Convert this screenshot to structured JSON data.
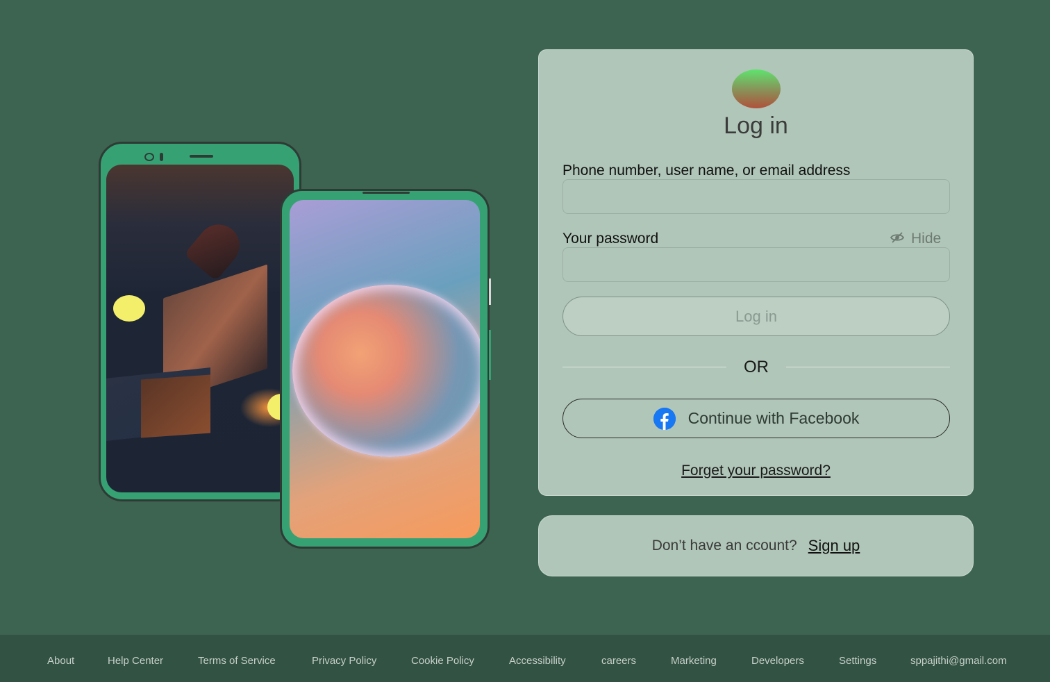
{
  "login": {
    "title": "Log in",
    "username_label": "Phone number, user name, or email address",
    "username_value": "",
    "password_label": "Your password",
    "password_value": "",
    "hide_label": "Hide",
    "submit_label": "Log in",
    "or_text": "OR",
    "facebook_label": "Continue with Facebook",
    "forgot_label": "Forget your password?"
  },
  "signup": {
    "prompt": "Don’t have an ccount?",
    "link_label": "Sign up"
  },
  "footer": {
    "links": [
      "About",
      "Help Center",
      "Terms of Service",
      "Privacy Policy",
      "Cookie Policy",
      "Accessibility",
      "careers",
      "Marketing",
      "Developers",
      "Settings",
      "sppajithi@gmail.com"
    ]
  },
  "icons": {
    "hide": "eye-slash-icon",
    "facebook": "facebook-icon",
    "logo": "app-logo"
  },
  "colors": {
    "background": "#3d6351",
    "card": "#b0c6b8",
    "footer": "#325243",
    "phone_frame": "#36a274",
    "facebook_blue": "#1877f2"
  }
}
